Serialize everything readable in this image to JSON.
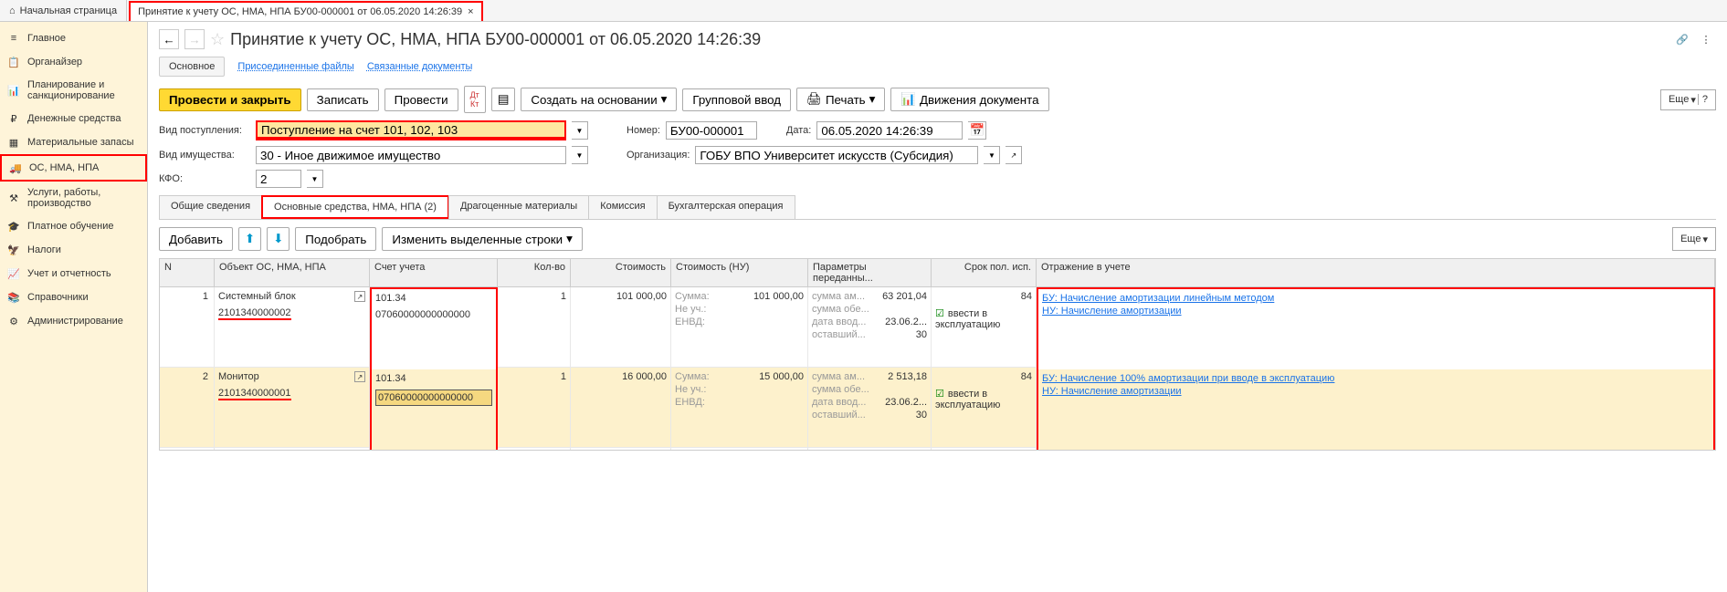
{
  "tabs": {
    "home": "Начальная страница",
    "doc": "Принятие к учету ОС, НМА, НПА БУ00-000001 от 06.05.2020 14:26:39"
  },
  "sidebar": [
    {
      "label": "Главное"
    },
    {
      "label": "Органайзер"
    },
    {
      "label": "Планирование и санкционирование"
    },
    {
      "label": "Денежные средства"
    },
    {
      "label": "Материальные запасы"
    },
    {
      "label": "ОС, НМА, НПА"
    },
    {
      "label": "Услуги, работы, производство"
    },
    {
      "label": "Платное обучение"
    },
    {
      "label": "Налоги"
    },
    {
      "label": "Учет и отчетность"
    },
    {
      "label": "Справочники"
    },
    {
      "label": "Администрирование"
    }
  ],
  "title": "Принятие к учету ОС, НМА, НПА БУ00-000001 от 06.05.2020 14:26:39",
  "links": {
    "main": "Основное",
    "files": "Присоединенные файлы",
    "related": "Связанные документы"
  },
  "toolbar": {
    "provesti_zakr": "Провести и закрыть",
    "zapisat": "Записать",
    "provesti": "Провести",
    "sozdat": "Создать на основании",
    "gruppa": "Групповой ввод",
    "pechat": "Печать",
    "dvij": "Движения документа",
    "eshe": "Еще"
  },
  "form": {
    "vid_post_label": "Вид поступления:",
    "vid_post_value": "Поступление на счет 101, 102, 103",
    "nomer_label": "Номер:",
    "nomer_value": "БУ00-000001",
    "data_label": "Дата:",
    "data_value": "06.05.2020 14:26:39",
    "vid_im_label": "Вид имущества:",
    "vid_im_value": "30 - Иное движимое имущество",
    "org_label": "Организация:",
    "org_value": "ГОБУ ВПО Университет искусств (Субсидия)",
    "kfo_label": "КФО:",
    "kfo_value": "2"
  },
  "doc_tabs": [
    "Общие сведения",
    "Основные средства, НМА, НПА (2)",
    "Драгоценные материалы",
    "Комиссия",
    "Бухгалтерская операция"
  ],
  "sub_toolbar": {
    "add": "Добавить",
    "pick": "Подобрать",
    "change": "Изменить выделенные строки",
    "eshe": "Еще"
  },
  "grid": {
    "headers": {
      "n": "N",
      "obj": "Объект ОС, НМА, НПА",
      "acc": "Счет учета",
      "qty": "Кол-во",
      "cost": "Стоимость",
      "cost_nu": "Стоимость (НУ)",
      "params": "Параметры переданны...",
      "srok": "Срок пол. исп.",
      "otr": "Отражение в учете"
    },
    "rows": [
      {
        "n": "1",
        "obj_name": "Системный блок",
        "obj_num": "2101340000002",
        "acc1": "101.34",
        "acc2": "07060000000000000",
        "qty": "1",
        "cost": "101 000,00",
        "nu": [
          {
            "l": "Сумма:",
            "v": "101 000,00"
          },
          {
            "l": "Не уч.:",
            "v": ""
          },
          {
            "l": "ЕНВД:",
            "v": ""
          }
        ],
        "params": [
          {
            "l": "сумма ам...",
            "v": "63 201,04"
          },
          {
            "l": "сумма обе...",
            "v": ""
          },
          {
            "l": "дата ввод...",
            "v": "23.06.2..."
          },
          {
            "l": "оставший...",
            "v": "30"
          }
        ],
        "srok": "84",
        "vvesti": "ввести в эксплуатацию",
        "otr": [
          "БУ: Начисление амортизации линейным методом",
          "НУ: Начисление амортизации"
        ]
      },
      {
        "n": "2",
        "obj_name": "Монитор",
        "obj_num": "2101340000001",
        "acc1": "101.34",
        "acc2": "07060000000000000",
        "qty": "1",
        "cost": "16 000,00",
        "nu": [
          {
            "l": "Сумма:",
            "v": "15 000,00"
          },
          {
            "l": "Не уч.:",
            "v": ""
          },
          {
            "l": "ЕНВД:",
            "v": ""
          }
        ],
        "params": [
          {
            "l": "сумма ам...",
            "v": "2 513,18"
          },
          {
            "l": "сумма обе...",
            "v": ""
          },
          {
            "l": "дата ввод...",
            "v": "23.06.2..."
          },
          {
            "l": "оставший...",
            "v": "30"
          }
        ],
        "srok": "84",
        "vvesti": "ввести в эксплуатацию",
        "otr": [
          "БУ: Начисление 100% амортизации при вводе в эксплуатацию",
          "НУ: Начисление амортизации"
        ]
      }
    ]
  }
}
